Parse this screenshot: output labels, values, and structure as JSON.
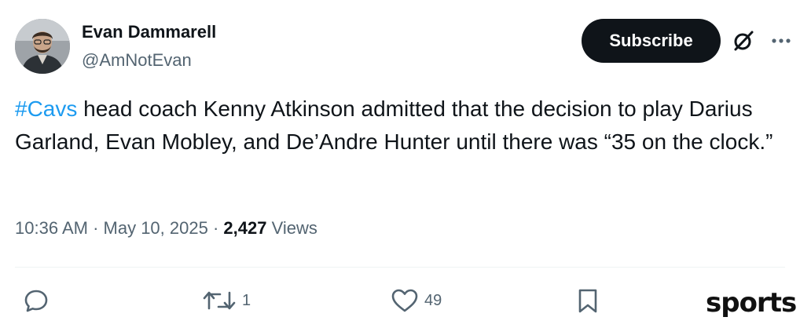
{
  "author": {
    "display_name": "Evan Dammarell",
    "handle": "@AmNotEvan"
  },
  "header": {
    "subscribe_label": "Subscribe"
  },
  "tweet": {
    "hashtag": "#Cavs",
    "text": " head coach Kenny Atkinson admitted that the decision to play Darius Garland, Evan Mobley, and De’Andre Hunter until there was “35 on the clock.”",
    "time": "10:36 AM",
    "separator": " · ",
    "date": "May 10, 2025",
    "views_count": "2,427",
    "views_label": " Views"
  },
  "actions": {
    "reply_count": "",
    "repost_count": "1",
    "like_count": "49"
  },
  "watermark": {
    "text": "sports"
  },
  "icons": {
    "reply": "reply-icon",
    "repost": "repost-icon",
    "like": "heart-icon",
    "bookmark": "bookmark-icon",
    "grok": "grok-icon",
    "more": "more-dots-icon"
  },
  "colors": {
    "accent": "#1d9bf0",
    "text": "#0f1419",
    "muted": "#536471",
    "button_bg": "#0f1419"
  }
}
